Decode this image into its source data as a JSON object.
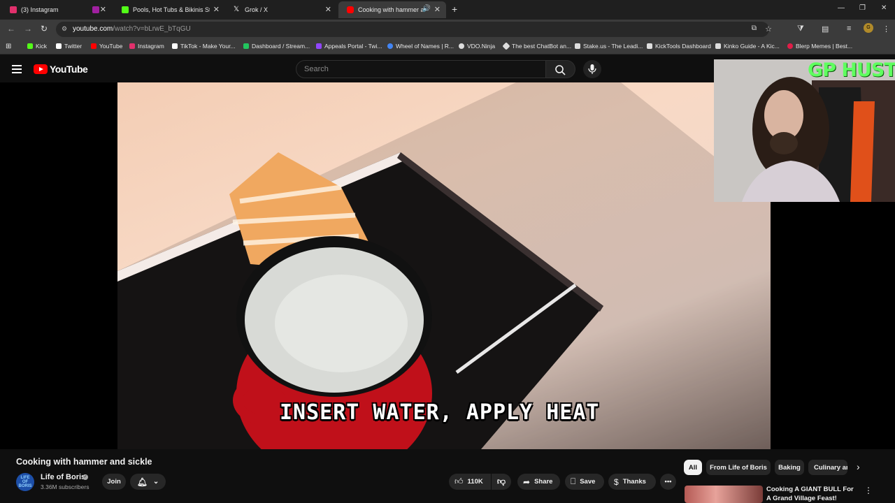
{
  "browser": {
    "tabs": [
      {
        "label": "(3) Instagram",
        "color": "#e1306c"
      },
      {
        "label": "",
        "color": "#a020a0"
      },
      {
        "label": "Pools, Hot Tubs & Bikinis Strea",
        "color": "#53fc18"
      },
      {
        "label": "Grok / X",
        "color": "#ffffff"
      },
      {
        "label": "Cooking with hammer and",
        "color": "#ff0000"
      }
    ],
    "url_host": "youtube.com",
    "url_path": "/watch?v=bLrwE_bTqGU",
    "bookmarks": [
      {
        "label": "Kick",
        "color": "#53fc18"
      },
      {
        "label": "Twitter",
        "color": "#ffffff"
      },
      {
        "label": "YouTube",
        "color": "#ff0000"
      },
      {
        "label": "Instagram",
        "color": "#e1306c"
      },
      {
        "label": "TikTok - Make Your...",
        "color": "#ffffff"
      },
      {
        "label": "Dashboard / Stream...",
        "color": "#22c55e"
      },
      {
        "label": "Appeals Portal - Twi...",
        "color": "#9146ff"
      },
      {
        "label": "Wheel of Names | R...",
        "color": "#4285f4"
      },
      {
        "label": "VDO.Ninja",
        "color": "#dddddd"
      },
      {
        "label": "The best ChatBot an...",
        "color": "#dddddd"
      },
      {
        "label": "Stake.us - The Leadi...",
        "color": "#dddddd"
      },
      {
        "label": "KickTools Dashboard",
        "color": "#dddddd"
      },
      {
        "label": "Kinko Guide - A Kic...",
        "color": "#dddddd"
      },
      {
        "label": "Blerp Memes | Best...",
        "color": "#e11d48"
      }
    ]
  },
  "youtube": {
    "logo_text": "YouTube",
    "search_placeholder": "Search"
  },
  "video": {
    "caption": "INSERT WATER, APPLY HEAT",
    "webcam_title": "GP HUSTLA",
    "title": "Cooking with hammer and sickle",
    "channel": {
      "avatar_text": "LIFE OF BORIS",
      "name": "Life of Boris",
      "subscribers": "3.36M subscribers"
    },
    "join_label": "Join",
    "like_count": "110K",
    "share_label": "Share",
    "save_label": "Save",
    "thanks_label": "Thanks"
  },
  "chips": [
    "All",
    "From Life of Boris",
    "Baking",
    "Culinary ar"
  ],
  "recommendation": {
    "title": "Cooking A GIANT BULL For A Grand Village Feast!"
  }
}
